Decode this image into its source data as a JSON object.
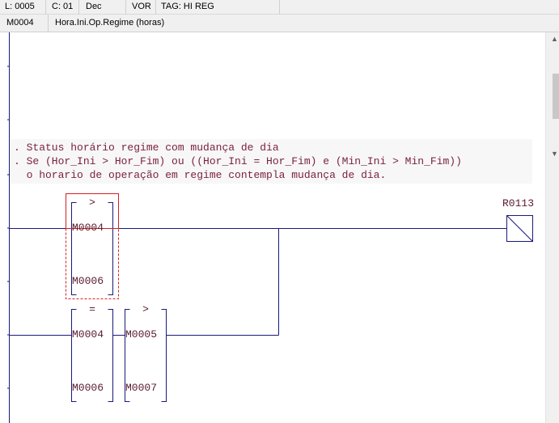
{
  "status_bar": {
    "line": "L: 0005",
    "column": "C: 01",
    "format": "Dec",
    "mode": "VOR",
    "tag": "TAG: HI REG"
  },
  "info_bar": {
    "address": "M0004",
    "description": "Hora.Ini.Op.Regime (horas)"
  },
  "ladder": {
    "comments": [
      ". Status horário regime com mudança de dia",
      ". Se (Hor_Ini > Hor_Fim) ou ((Hor_Ini = Hor_Fim) e (Min_Ini > Min_Fim))",
      "  o horario de operação em regime contempla mudança de dia."
    ],
    "blocks": [
      {
        "operator": ">",
        "input_a": "M0004",
        "input_b": "M0006"
      },
      {
        "operator": "=",
        "input_a": "M0004",
        "input_b": "M0006"
      },
      {
        "operator": ">",
        "input_a": "M0005",
        "input_b": "M0007"
      }
    ],
    "coil": "R0113"
  },
  "colors": {
    "rung_line": "#1a1a7a",
    "comment_text": "#7a1f3d",
    "label_text": "#5a1a2e",
    "selection": "#d42020"
  },
  "scrollbar": {
    "up_icon": "triangle-up-icon",
    "down_icon": "triangle-down-icon"
  }
}
